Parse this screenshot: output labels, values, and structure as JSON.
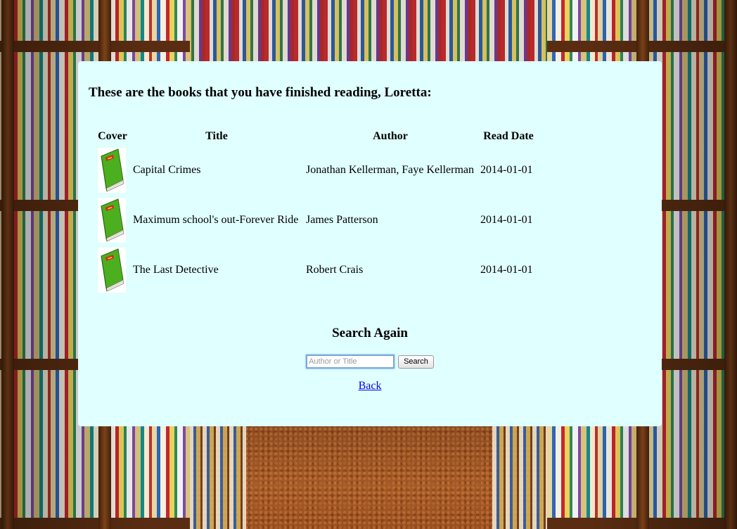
{
  "page": {
    "heading": "These are the books that you have finished reading, Loretta:"
  },
  "table": {
    "headers": {
      "cover": "Cover",
      "title": "Title",
      "author": "Author",
      "read_date": "Read Date"
    },
    "rows": [
      {
        "title": "Capital Crimes",
        "author": "Jonathan Kellerman, Faye Kellerman",
        "read_date": "2014-01-01",
        "cover_icon": "book-cover-icon"
      },
      {
        "title": "Maximum school's out-Forever Ride",
        "author": "James Patterson",
        "read_date": "2014-01-01",
        "cover_icon": "book-cover-icon"
      },
      {
        "title": "The Last Detective",
        "author": "Robert Crais",
        "read_date": "2014-01-01",
        "cover_icon": "book-cover-icon"
      }
    ]
  },
  "search": {
    "title": "Search Again",
    "placeholder": "Author or Title",
    "value": "",
    "button_label": "Search"
  },
  "nav": {
    "back_label": "Back"
  },
  "colors": {
    "panel_background": "#e0ffff",
    "link": "#0000ee",
    "book_cover_green": "#4caf1f"
  }
}
